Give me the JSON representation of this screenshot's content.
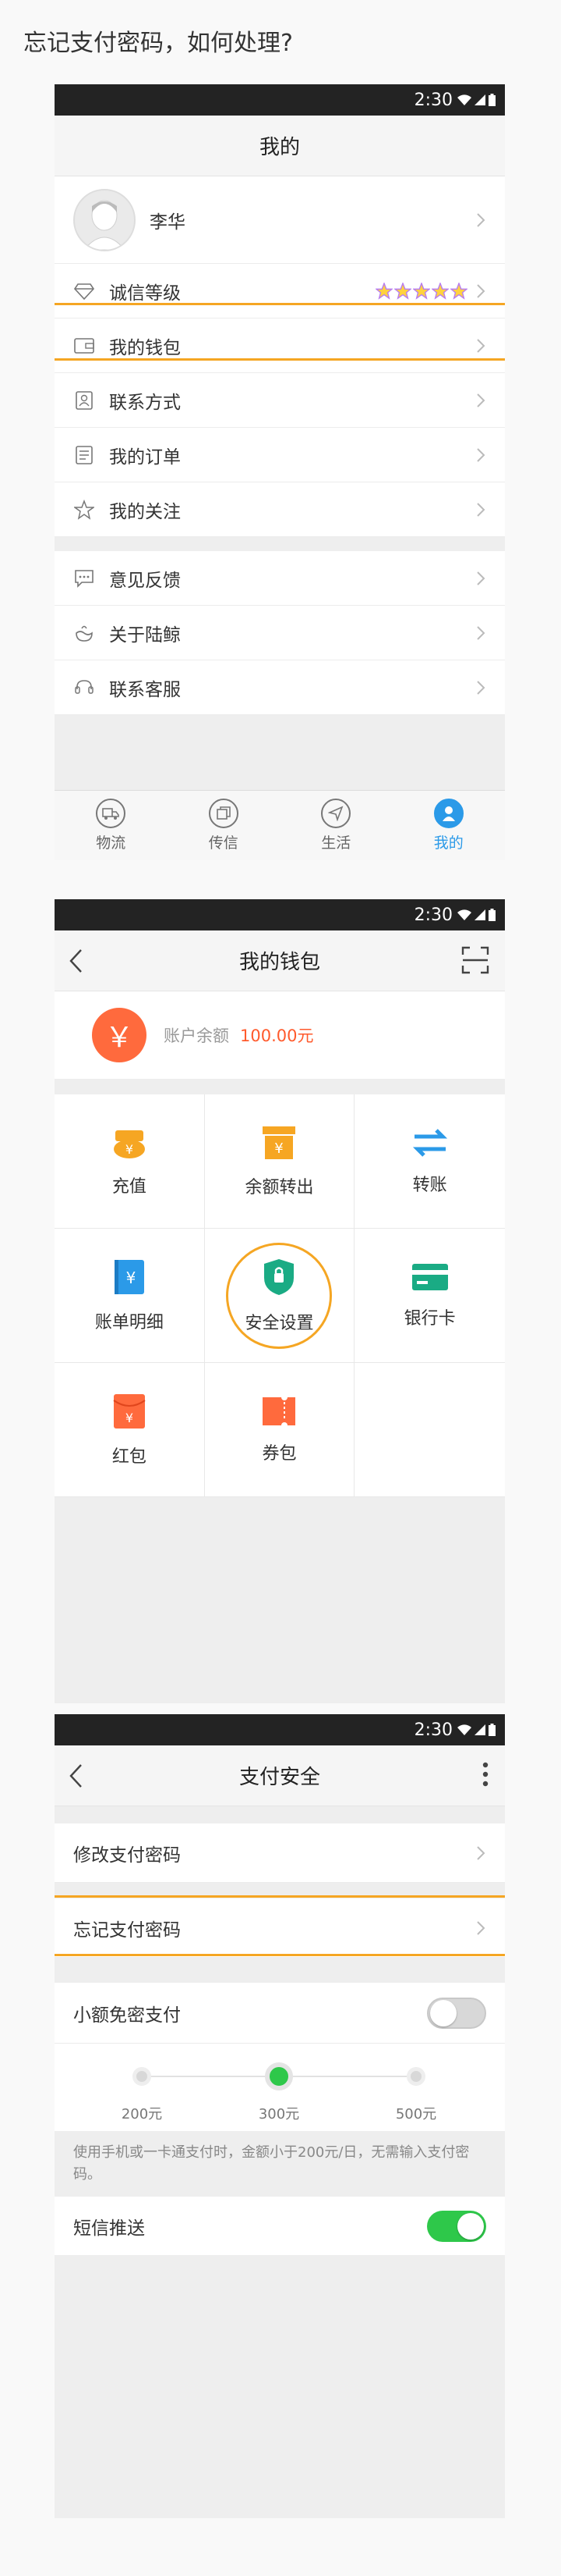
{
  "heading": "忘记支付密码，如何处理?",
  "colors": {
    "highlight": "#f5a623",
    "accent": "#2b9ae8",
    "toggle_on": "#2ec84a",
    "balance": "#ff5a2c"
  },
  "status": {
    "time": "2:30",
    "icons": [
      "wifi-icon",
      "signal-icon",
      "battery-icon"
    ]
  },
  "screen1": {
    "title": "我的",
    "user": {
      "name": "李华"
    },
    "menu": [
      {
        "label": "诚信等级",
        "icon": "diamond-icon"
      },
      {
        "label": "我的钱包",
        "icon": "wallet-icon"
      },
      {
        "label": "联系方式",
        "icon": "contact-icon"
      },
      {
        "label": "我的订单",
        "icon": "order-icon"
      },
      {
        "label": "我的关注",
        "icon": "star-icon"
      }
    ],
    "menu2": [
      {
        "label": "意见反馈",
        "icon": "feedback-icon"
      },
      {
        "label": "关于陆鲸",
        "icon": "whale-icon"
      },
      {
        "label": "联系客服",
        "icon": "service-icon"
      }
    ],
    "rating": {
      "stars": 5
    },
    "tabs": [
      {
        "label": "物流",
        "icon": "truck-icon"
      },
      {
        "label": "传信",
        "icon": "message-icon"
      },
      {
        "label": "生活",
        "icon": "compass-icon"
      },
      {
        "label": "我的",
        "icon": "user-icon",
        "active": true
      }
    ]
  },
  "screen2": {
    "title": "我的钱包",
    "balance": {
      "symbol": "￥",
      "label": "账户余额",
      "value": "100.00元"
    },
    "grid": [
      {
        "label": "充值",
        "icon": "recharge-icon",
        "color": "#f6a623"
      },
      {
        "label": "余额转出",
        "icon": "withdraw-icon",
        "color": "#f6a623"
      },
      {
        "label": "转账",
        "icon": "transfer-icon",
        "color": "#2b9ae8"
      },
      {
        "label": "账单明细",
        "icon": "bill-icon",
        "color": "#2b9ae8"
      },
      {
        "label": "安全设置",
        "icon": "shield-icon",
        "color": "#1aab84"
      },
      {
        "label": "银行卡",
        "icon": "bank-card-icon",
        "color": "#1aab84"
      },
      {
        "label": "红包",
        "icon": "red-packet-icon",
        "color": "#ff6a3d"
      },
      {
        "label": "券包",
        "icon": "coupon-icon",
        "color": "#ff6a3d"
      }
    ]
  },
  "screen3": {
    "title": "支付安全",
    "change_password": "修改支付密码",
    "forgot_password": "忘记支付密码",
    "small_amount": {
      "label": "小额免密支付",
      "on": false
    },
    "amounts": [
      "200元",
      "300元",
      "500元"
    ],
    "selected_amount": "300元",
    "note": "使用手机或一卡通支付时，金额小于200元/日，无需输入支付密码。",
    "sms": {
      "label": "短信推送",
      "on": true
    }
  }
}
